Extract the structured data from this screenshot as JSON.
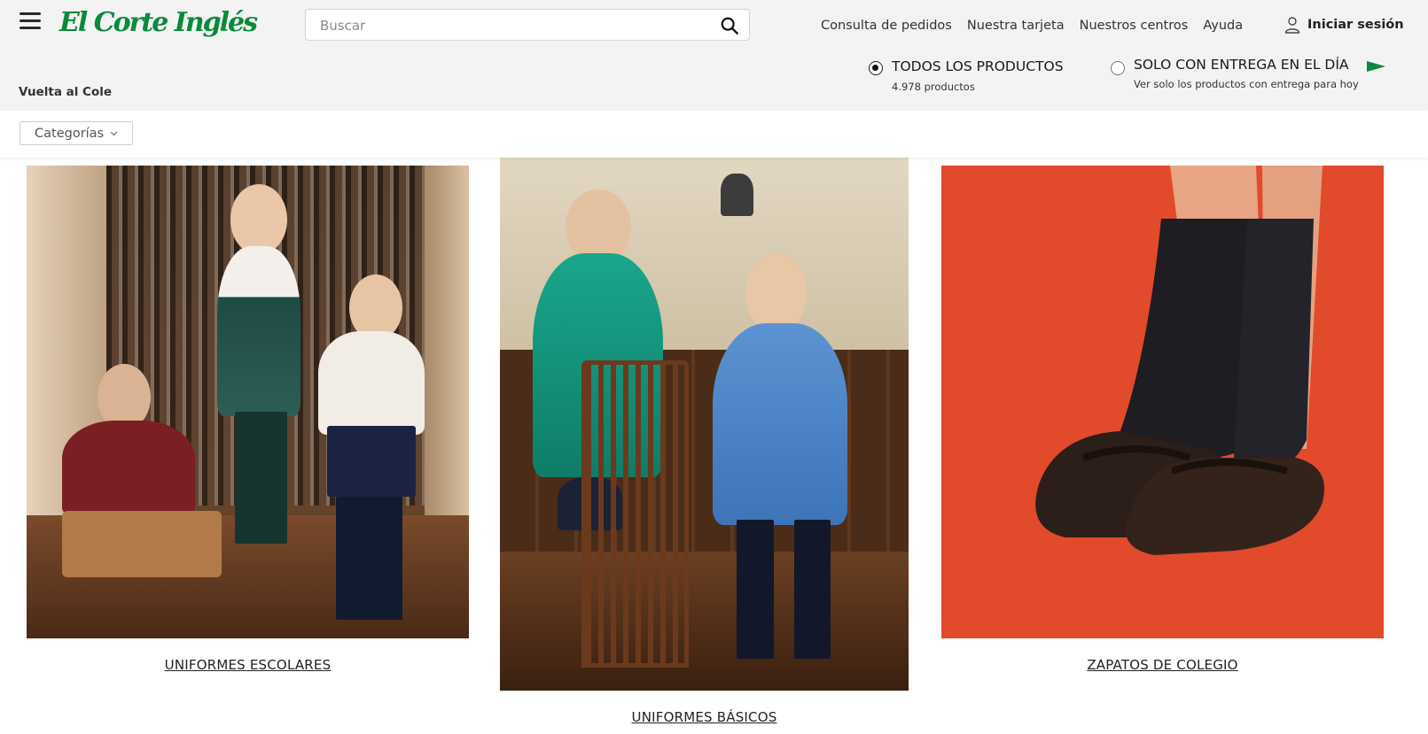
{
  "header": {
    "logo_text": "El Corte Inglés",
    "search": {
      "placeholder": "Buscar",
      "value": ""
    },
    "links": [
      "Consulta de pedidos",
      "Nuestra tarjeta",
      "Nuestros centros",
      "Ayuda"
    ],
    "login_label": "Iniciar sesión",
    "brand_color": "#0a8a3a"
  },
  "delivery_filter": {
    "all": {
      "title": "TODOS LOS PRODUCTOS",
      "subtitle": "4.978 productos",
      "selected": true
    },
    "same_day": {
      "title": "SOLO CON ENTREGA EN EL DÍA",
      "subtitle": "Ver solo los productos con entrega para hoy",
      "selected": false
    }
  },
  "breadcrumb": "Vuelta al Cole",
  "filters": {
    "categories_label": "Categorías"
  },
  "cards": [
    {
      "caption": "UNIFORMES ESCOLARES",
      "image_icon": "uniformes-escolares-photo"
    },
    {
      "caption": "UNIFORMES BÁSICOS",
      "image_icon": "uniformes-basicos-photo"
    },
    {
      "caption": "ZAPATOS DE COLEGIO",
      "image_icon": "zapatos-de-colegio-photo"
    }
  ]
}
